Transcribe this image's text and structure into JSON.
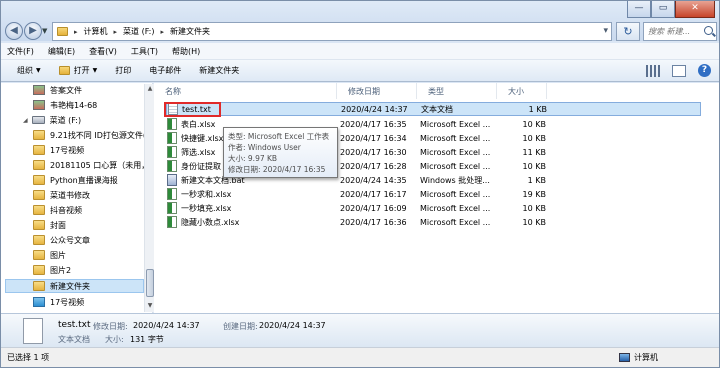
{
  "window": {
    "minimize": "—",
    "maximize": "▭",
    "close": "✕"
  },
  "address": {
    "parts": [
      "计算机",
      "菜道 (F:)",
      "新建文件夹"
    ]
  },
  "search": {
    "placeholder": "搜索 新建..."
  },
  "menu": [
    "文件(F)",
    "编辑(E)",
    "查看(V)",
    "工具(T)",
    "帮助(H)"
  ],
  "toolbar": {
    "organize": "组织",
    "open": "打开",
    "print": "打印",
    "email": "电子邮件",
    "new_folder": "新建文件夹"
  },
  "nav": {
    "items": [
      {
        "label": "答案文件",
        "icon": "library"
      },
      {
        "label": "韦艳梅14-68",
        "icon": "library"
      },
      {
        "label": "菜道 (F:)",
        "icon": "drive"
      },
      {
        "label": "9.21找不同 ID打包源文件(",
        "icon": "folder"
      },
      {
        "label": "17号视频",
        "icon": "folder"
      },
      {
        "label": "20181105 口心算（未用，",
        "icon": "folder"
      },
      {
        "label": "Python直播课海报",
        "icon": "folder"
      },
      {
        "label": "菜道书修改",
        "icon": "folder"
      },
      {
        "label": "抖音视频",
        "icon": "folder"
      },
      {
        "label": "封面",
        "icon": "folder"
      },
      {
        "label": "公众号文章",
        "icon": "folder"
      },
      {
        "label": "图片",
        "icon": "folder"
      },
      {
        "label": "图片2",
        "icon": "folder"
      },
      {
        "label": "新建文件夹",
        "icon": "folder"
      },
      {
        "label": "17号视频",
        "icon": "folder-blue"
      }
    ]
  },
  "columns": {
    "name": "名称",
    "modified": "修改日期",
    "type": "类型",
    "size": "大小"
  },
  "files": [
    {
      "name": "test.txt",
      "date": "2020/4/24 14:37",
      "type": "文本文档",
      "size": "1 KB",
      "icon": "txt"
    },
    {
      "name": "表白.xlsx",
      "date": "2020/4/17 16:35",
      "type": "Microsoft Excel ...",
      "size": "10 KB",
      "icon": "xlsx"
    },
    {
      "name": "快捷键.xlsx",
      "date": "2020/4/17 16:34",
      "type": "Microsoft Excel ...",
      "size": "10 KB",
      "icon": "xlsx"
    },
    {
      "name": "筛选.xlsx",
      "date": "2020/4/17 16:30",
      "type": "Microsoft Excel ...",
      "size": "11 KB",
      "icon": "xlsx"
    },
    {
      "name": "身份证提取",
      "date": "2020/4/17 16:28",
      "type": "Microsoft Excel ...",
      "size": "10 KB",
      "icon": "xlsx"
    },
    {
      "name": "新建文本文档.bat",
      "date": "2020/4/24 14:35",
      "type": "Windows 批处理...",
      "size": "1 KB",
      "icon": "bat"
    },
    {
      "name": "一秒求和.xlsx",
      "date": "2020/4/17 16:17",
      "type": "Microsoft Excel ...",
      "size": "19 KB",
      "icon": "xlsx"
    },
    {
      "name": "一秒填充.xlsx",
      "date": "2020/4/17 16:09",
      "type": "Microsoft Excel ...",
      "size": "10 KB",
      "icon": "xlsx"
    },
    {
      "name": "隐藏小数点.xlsx",
      "date": "2020/4/17 16:36",
      "type": "Microsoft Excel ...",
      "size": "10 KB",
      "icon": "xlsx"
    }
  ],
  "tooltip": {
    "type": "类型: Microsoft Excel 工作表",
    "author": "作者: Windows User",
    "size": "大小: 9.97 KB",
    "modified": "修改日期: 2020/4/17 16:35"
  },
  "details": {
    "filename": "test.txt",
    "modified_label": "修改日期:",
    "modified": "2020/4/24 14:37",
    "created_label": "创建日期:",
    "created": "2020/4/24 14:37",
    "type": "文本文档",
    "size_label": "大小:",
    "size": "131 字节"
  },
  "status": {
    "selected": "已选择 1 项",
    "location": "计算机"
  }
}
